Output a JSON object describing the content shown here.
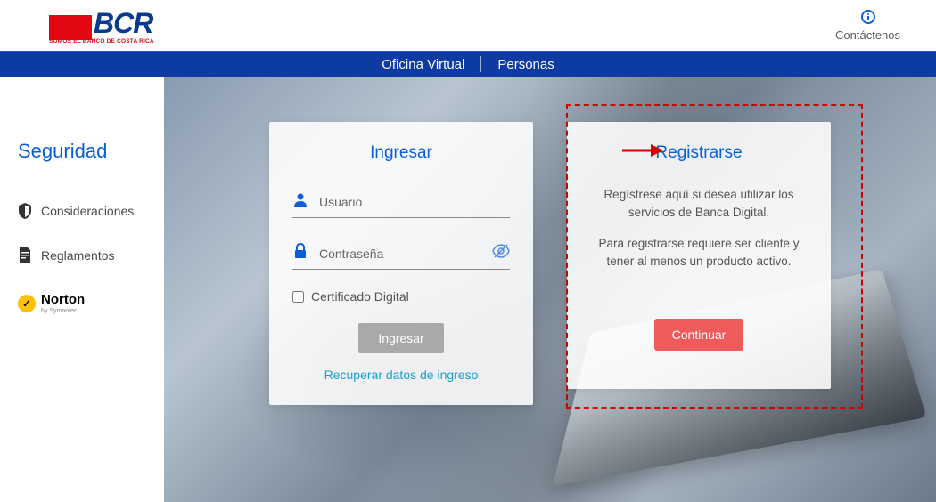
{
  "header": {
    "logo_text": "BCR",
    "logo_tag": "SOMOS EL BANCO DE COSTA RICA",
    "contact_label": "Contáctenos"
  },
  "nav": {
    "item1": "Oficina Virtual",
    "item2": "Personas"
  },
  "sidebar": {
    "title": "Seguridad",
    "item1": "Consideraciones",
    "item2": "Reglamentos",
    "norton_label": "Norton",
    "norton_sub": "by Symantec"
  },
  "login": {
    "title": "Ingresar",
    "user_label": "Usuario",
    "password_label": "Contraseña",
    "cert_label": "Certificado Digital",
    "submit_label": "Ingresar",
    "recover_label": "Recuperar datos de ingreso"
  },
  "register": {
    "title": "Registrarse",
    "text1": "Regístrese aquí si desea utilizar los servicios de Banca Digital.",
    "text2": "Para registrarse requiere ser cliente y tener al menos un producto activo.",
    "button_label": "Continuar"
  }
}
